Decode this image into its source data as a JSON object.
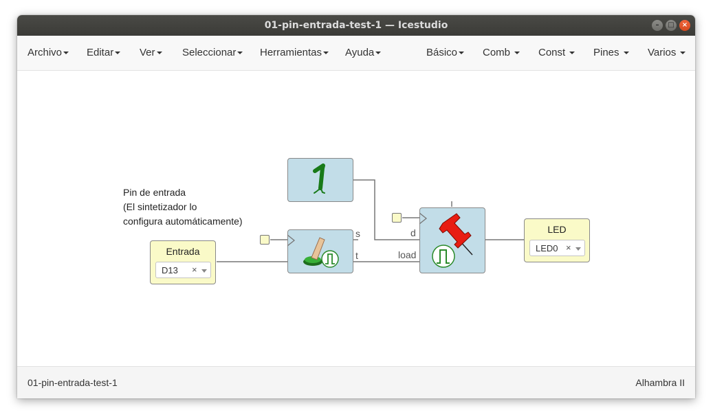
{
  "window": {
    "title": "01-pin-entrada-test-1 — Icestudio",
    "controls": {
      "minimize_icon": "–",
      "maximize_icon": "□",
      "close_icon": "×"
    }
  },
  "menu": {
    "left": [
      "Archivo",
      "Editar",
      "Ver",
      "Seleccionar",
      "Herramientas",
      "Ayuda"
    ],
    "right": [
      "Básico",
      "Comb",
      "Const",
      "Pines",
      "Varios"
    ]
  },
  "canvas": {
    "comment": [
      "Pin de entrada",
      "(El sintetizador lo",
      "configura automáticamente)"
    ],
    "input_block": {
      "title": "Entrada",
      "pin": "D13"
    },
    "output_block": {
      "title": "LED",
      "pin": "LED0"
    },
    "constant_block": {
      "icon": "bit-one-icon"
    },
    "button_block": {
      "icon": "push-button-icon",
      "ports": {
        "s": "s",
        "t": "t"
      }
    },
    "register_block": {
      "icon": "pushpin-icon",
      "ports": {
        "d": "d",
        "load": "load"
      }
    },
    "clear_glyph": "×",
    "colors": {
      "io_block": "#fafac8",
      "logic_block": "#c2dde8",
      "wire": "#777777"
    }
  },
  "status": {
    "file": "01-pin-entrada-test-1",
    "board": "Alhambra II"
  }
}
